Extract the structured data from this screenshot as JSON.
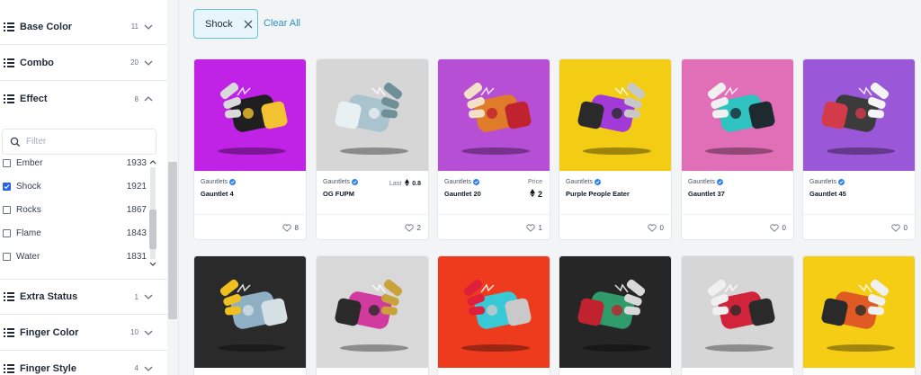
{
  "filters": {
    "base_color": {
      "label": "Base Color",
      "count": "11"
    },
    "combo": {
      "label": "Combo",
      "count": "20"
    },
    "effect": {
      "label": "Effect",
      "count": "8"
    },
    "extra_status": {
      "label": "Extra Status",
      "count": "1"
    },
    "finger_color": {
      "label": "Finger Color",
      "count": "10"
    },
    "finger_style": {
      "label": "Finger Style",
      "count": "4"
    }
  },
  "effect_search": {
    "placeholder": "Filter"
  },
  "effect_options": [
    {
      "label": "Ember",
      "count": "1933",
      "checked": false
    },
    {
      "label": "Shock",
      "count": "1921",
      "checked": true
    },
    {
      "label": "Rocks",
      "count": "1867",
      "checked": false
    },
    {
      "label": "Flame",
      "count": "1843",
      "checked": false
    },
    {
      "label": "Water",
      "count": "1831",
      "checked": false
    }
  ],
  "active_filter_chip": {
    "label": "Shock"
  },
  "clear_all_label": "Clear All",
  "cards": [
    {
      "collection": "Gauntlets",
      "title": "Gauntlet 4",
      "price_label": "",
      "last_value": "",
      "price_value": "",
      "likes": "8",
      "bg": "#c022e6",
      "palette": [
        "#1f1f1f",
        "#f2c230",
        "#d9d9d9"
      ]
    },
    {
      "collection": "Gauntlets",
      "title": "OG FUPM",
      "price_label": "Last",
      "last_value": "0.8",
      "price_value": "",
      "likes": "2",
      "bg": "#d6d6d6",
      "palette": [
        "#a9c4cf",
        "#e8f0f3",
        "#6f8f99"
      ]
    },
    {
      "collection": "Gauntlets",
      "title": "Gauntlet 20",
      "price_label": "Price",
      "last_value": "",
      "price_value": "2",
      "likes": "1",
      "bg": "#b74fd6",
      "palette": [
        "#e07b2a",
        "#c0232f",
        "#f4e0c6"
      ]
    },
    {
      "collection": "Gauntlets",
      "title": "Purple People Eater",
      "price_label": "",
      "last_value": "",
      "price_value": "",
      "likes": "0",
      "bg": "#f2cd14",
      "palette": [
        "#a23ad8",
        "#2a2a2a",
        "#c8c8c8"
      ]
    },
    {
      "collection": "Gauntlets",
      "title": "Gauntlet 37",
      "price_label": "",
      "last_value": "",
      "price_value": "",
      "likes": "0",
      "bg": "#e06fb7",
      "palette": [
        "#2ec3c1",
        "#1d2a30",
        "#f0f0f0"
      ]
    },
    {
      "collection": "Gauntlets",
      "title": "Gauntlet 45",
      "price_label": "",
      "last_value": "",
      "price_value": "",
      "likes": "0",
      "bg": "#9a58d8",
      "palette": [
        "#3b3b3b",
        "#d43b4a",
        "#f4f4f4"
      ]
    },
    {
      "collection": "",
      "title": "",
      "price_label": "",
      "last_value": "",
      "price_value": "",
      "likes": "",
      "bg": "#2a2a2a",
      "palette": [
        "#8fb0c4",
        "#d6dfe4",
        "#f0c020"
      ]
    },
    {
      "collection": "",
      "title": "",
      "price_label": "",
      "last_value": "",
      "price_value": "",
      "likes": "",
      "bg": "#d8d8d8",
      "palette": [
        "#d13a9f",
        "#2a2a2a",
        "#c9a23a"
      ]
    },
    {
      "collection": "",
      "title": "",
      "price_label": "",
      "last_value": "",
      "price_value": "",
      "likes": "",
      "bg": "#ee3b1e",
      "palette": [
        "#39c9d6",
        "#c9c9c9",
        "#e01f3d"
      ]
    },
    {
      "collection": "",
      "title": "",
      "price_label": "",
      "last_value": "",
      "price_value": "",
      "likes": "",
      "bg": "#262626",
      "palette": [
        "#2f9a6a",
        "#c0232f",
        "#d9d9d9"
      ]
    },
    {
      "collection": "",
      "title": "",
      "price_label": "",
      "last_value": "",
      "price_value": "",
      "likes": "",
      "bg": "#d6d6d6",
      "palette": [
        "#d1243a",
        "#2a2a2a",
        "#f0f0f0"
      ]
    },
    {
      "collection": "",
      "title": "",
      "price_label": "",
      "last_value": "",
      "price_value": "",
      "likes": "",
      "bg": "#f4cd14",
      "palette": [
        "#e05a24",
        "#2a2a2a",
        "#f0f0f0"
      ]
    }
  ],
  "colors": {
    "accent": "#2e90c9",
    "chip_border": "#67c3d9",
    "chip_bg": "#e8f5fa",
    "verified": "#2f80ed",
    "checkbox": "#2563eb"
  }
}
